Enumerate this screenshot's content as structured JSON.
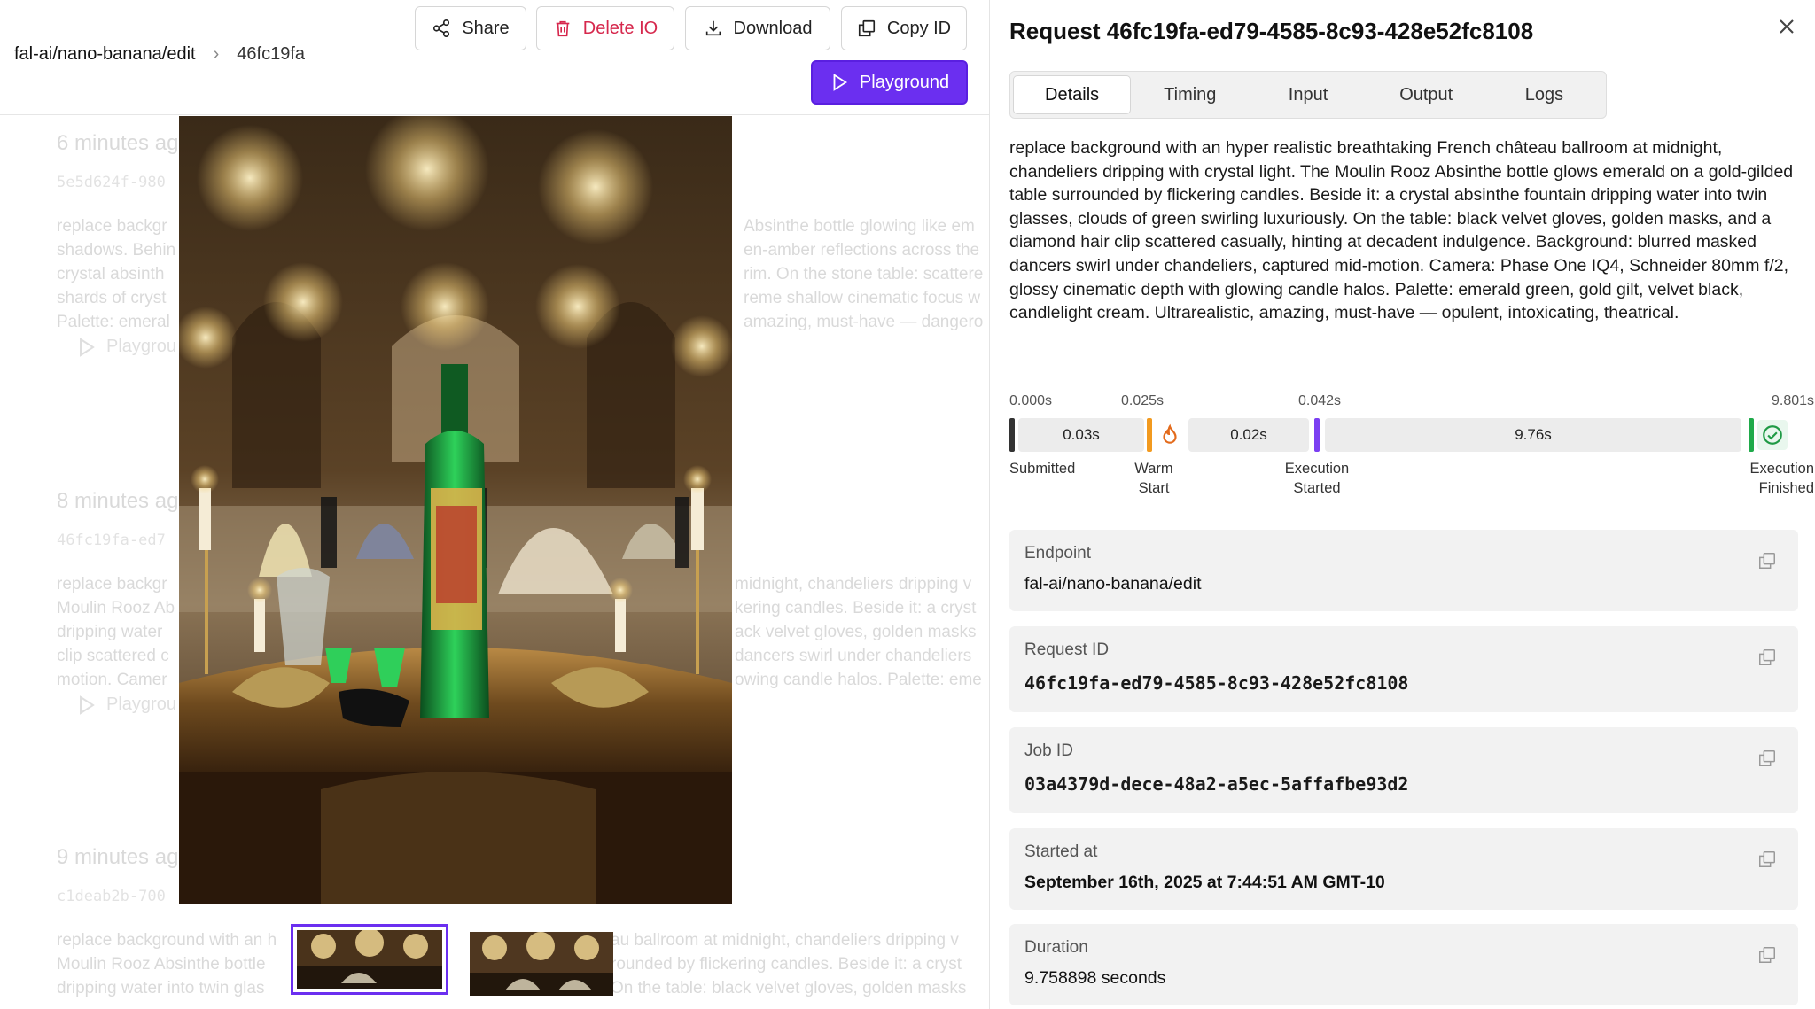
{
  "breadcrumb": {
    "app": "fal-ai/nano-banana/edit",
    "current": "46fc19fa"
  },
  "toolbar": {
    "share": "Share",
    "delete": "Delete IO",
    "download": "Download",
    "copy_id": "Copy ID",
    "playground": "Playground",
    "delete_color": "#d6284d",
    "accent": "#6b2ff0"
  },
  "background_entries": [
    {
      "when": "6 minutes ago",
      "id": "5e5d624f-980",
      "prompt": [
        "replace backgr",
        "shadows. Behin",
        "crystal absinth",
        "shards of cryst",
        "Palette: emeral"
      ],
      "prompt_right": [
        "Absinthe bottle glowing like em",
        "en-amber reflections across the",
        "rim. On the stone table: scattere",
        "reme shallow cinematic focus w",
        "amazing, must-have — dangero"
      ],
      "playground": "Playgrou"
    },
    {
      "when": "8 minutes ago",
      "id": "46fc19fa-ed7",
      "prompt": [
        "replace backgr",
        "Moulin Rooz Ab",
        "dripping water",
        "clip scattered c",
        "motion. Camer"
      ],
      "prompt_right": [
        "midnight, chandeliers dripping v",
        "kering candles. Beside it: a cryst",
        "ack velvet gloves, golden masks",
        "dancers swirl under chandeliers",
        "owing candle halos. Palette: eme"
      ],
      "playground": "Playgrou"
    },
    {
      "when": "9 minutes ago",
      "id": "c1deab2b-700",
      "prompt": [
        "replace background with an h",
        "Moulin Rooz Absinthe bottle",
        "dripping water into twin glas"
      ],
      "prompt_right": [
        "au ballroom at midnight, chandeliers dripping v",
        "rounded by flickering candles. Beside it: a cryst",
        "On the table: black velvet gloves, golden masks"
      ],
      "playground": "Playgrou"
    }
  ],
  "panel": {
    "title": "Request 46fc19fa-ed79-4585-8c93-428e52fc8108",
    "tabs": [
      "Details",
      "Timing",
      "Input",
      "Output",
      "Logs"
    ],
    "active_tab": "Details",
    "prompt": "replace background with an hyper realistic breathtaking French château ballroom at midnight, chandeliers dripping with crystal light. The Moulin Rooz Absinthe bottle glows emerald on a gold-gilded table surrounded by flickering candles. Beside it: a crystal absinthe fountain dripping water into twin glasses, clouds of green swirling luxuriously. On the table: black velvet gloves, golden masks, and a diamond hair clip scattered casually, hinting at decadent indulgence. Background: blurred masked dancers swirl under chandeliers, captured mid-motion. Camera: Phase One IQ4, Schneider 80mm f/2, glossy cinematic depth with glowing candle halos. Palette: emerald green, gold gilt, velvet black, candlelight cream. Ultrarealistic, amazing, must-have — opulent, intoxicating, theatrical.",
    "timing": {
      "ticks": [
        "0.000s",
        "0.025s",
        "0.042s",
        "9.801s"
      ],
      "segments": [
        "0.03s",
        "0.02s",
        "9.76s"
      ],
      "stages": {
        "submitted": "Submitted",
        "warm_start": [
          "Warm",
          "Start"
        ],
        "execution_started": [
          "Execution",
          "Started"
        ],
        "execution_finished": [
          "Execution",
          "Finished"
        ]
      },
      "colors": {
        "submitted": "#333333",
        "warm": "#f29a1f",
        "started": "#7b3ff2",
        "finished": "#1faa4a"
      }
    },
    "cards": [
      {
        "label": "Endpoint",
        "value": "fal-ai/nano-banana/edit",
        "style": "normal"
      },
      {
        "label": "Request ID",
        "value": "46fc19fa-ed79-4585-8c93-428e52fc8108",
        "style": "mono"
      },
      {
        "label": "Job ID",
        "value": "03a4379d-dece-48a2-a5ec-5affafbe93d2",
        "style": "mono"
      },
      {
        "label": "Started at",
        "value": "September 16th, 2025 at 7:44:51 AM GMT-10",
        "style": "bold"
      },
      {
        "label": "Duration",
        "value": "9.758898 seconds",
        "style": "normal"
      }
    ]
  }
}
